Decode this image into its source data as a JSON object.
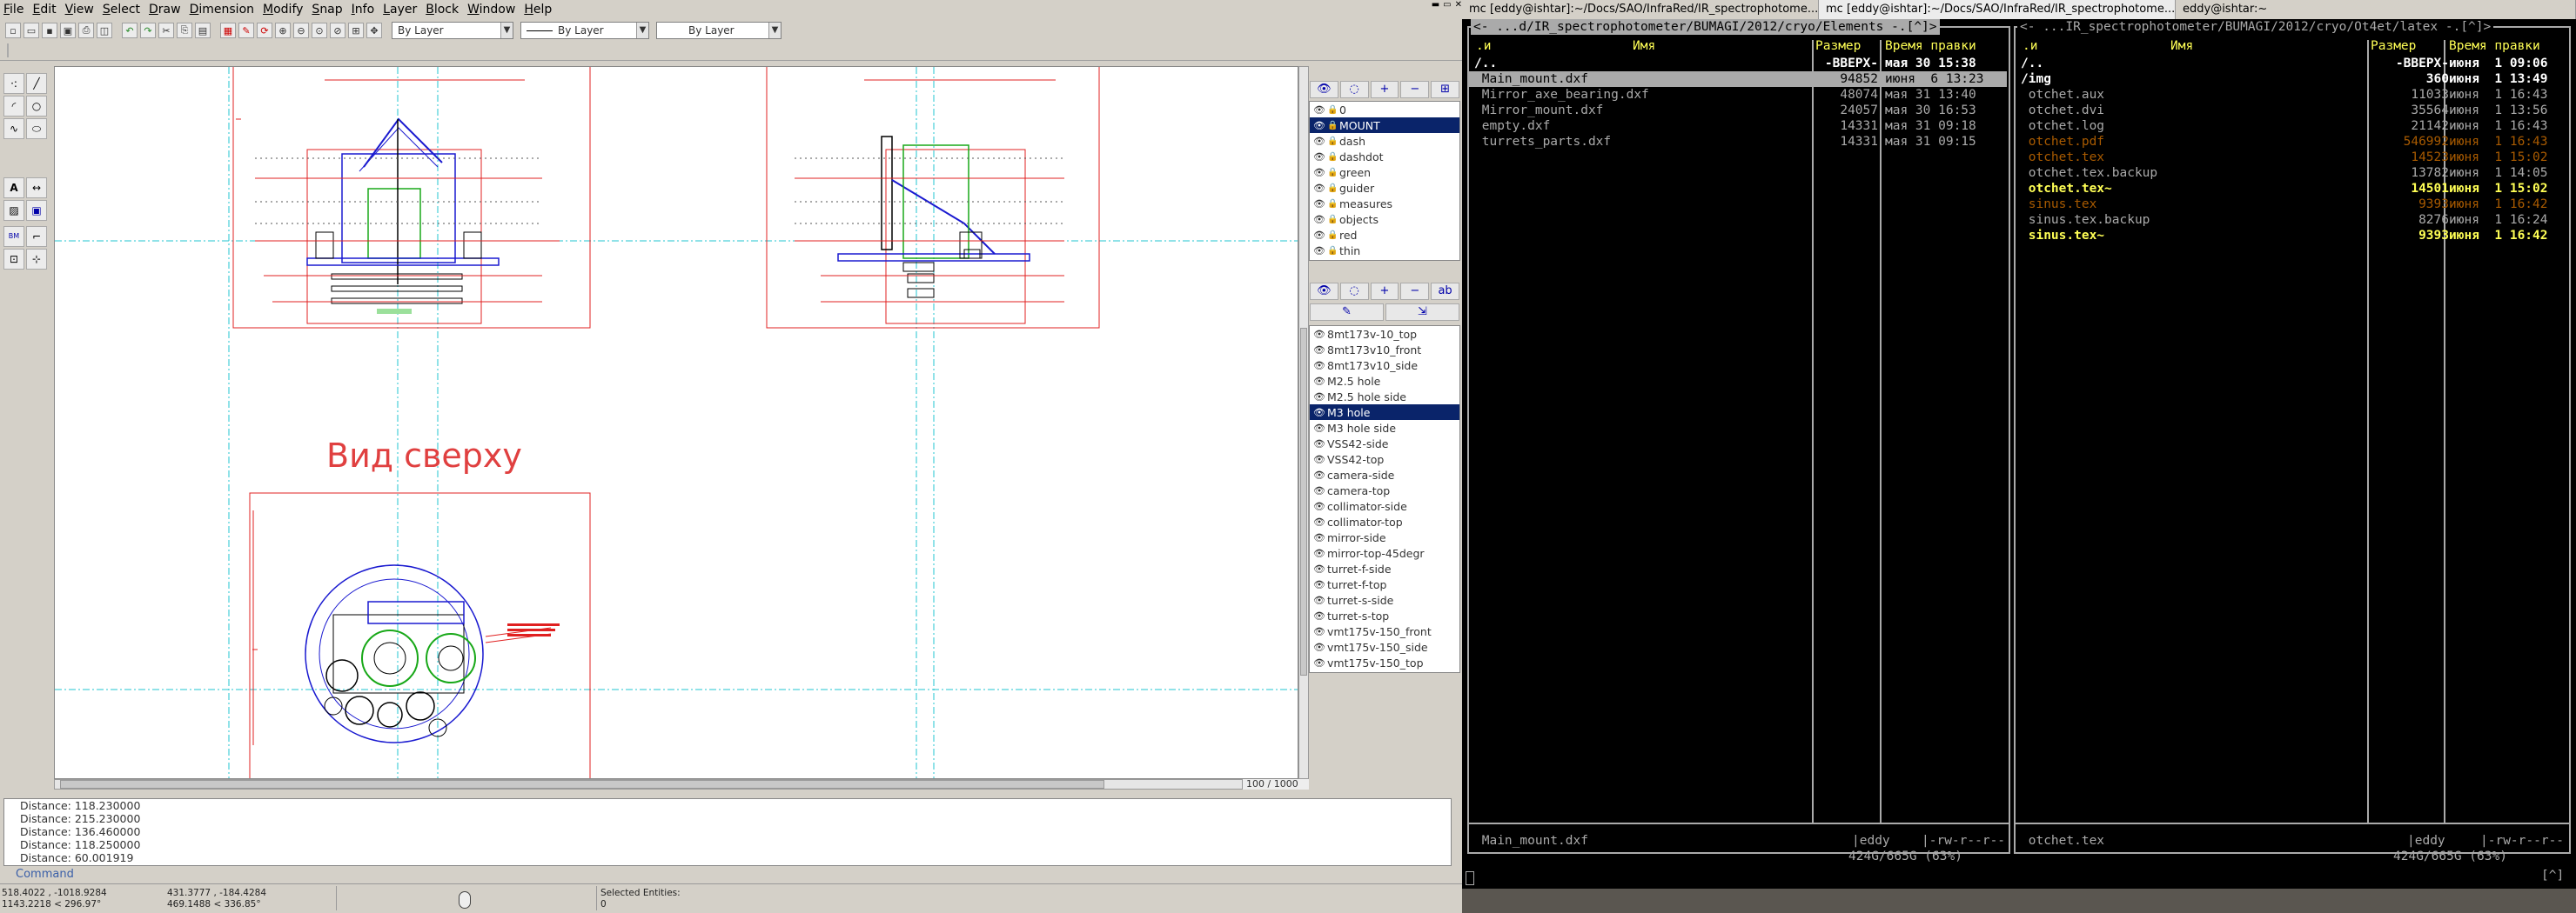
{
  "cad": {
    "menu": [
      "File",
      "Edit",
      "View",
      "Select",
      "Draw",
      "Dimension",
      "Modify",
      "Snap",
      "Info",
      "Layer",
      "Block",
      "Window",
      "Help"
    ],
    "pen_color": "By Layer",
    "pen_linetype": "By Layer",
    "pen_width": "By Layer",
    "drawing": {
      "view_label": "Вид сверху"
    },
    "zoom": "100 / 1000",
    "layers": [
      {
        "name": "0",
        "selected": false
      },
      {
        "name": "MOUNT",
        "selected": true
      },
      {
        "name": "dash",
        "selected": false
      },
      {
        "name": "dashdot",
        "selected": false
      },
      {
        "name": "green",
        "selected": false
      },
      {
        "name": "guider",
        "selected": false
      },
      {
        "name": "measures",
        "selected": false
      },
      {
        "name": "objects",
        "selected": false
      },
      {
        "name": "red",
        "selected": false
      },
      {
        "name": "thin",
        "selected": false
      }
    ],
    "blocks": [
      {
        "name": "8mt173v-10_top",
        "selected": false
      },
      {
        "name": "8mt173v10_front",
        "selected": false
      },
      {
        "name": "8mt173v10_side",
        "selected": false
      },
      {
        "name": "M2.5 hole",
        "selected": false
      },
      {
        "name": "M2.5 hole side",
        "selected": false
      },
      {
        "name": "M3 hole",
        "selected": true
      },
      {
        "name": "M3 hole side",
        "selected": false
      },
      {
        "name": "VSS42-side",
        "selected": false
      },
      {
        "name": "VSS42-top",
        "selected": false
      },
      {
        "name": "camera-side",
        "selected": false
      },
      {
        "name": "camera-top",
        "selected": false
      },
      {
        "name": "collimator-side",
        "selected": false
      },
      {
        "name": "collimator-top",
        "selected": false
      },
      {
        "name": "mirror-side",
        "selected": false
      },
      {
        "name": "mirror-top-45degr",
        "selected": false
      },
      {
        "name": "turret-f-side",
        "selected": false
      },
      {
        "name": "turret-f-top",
        "selected": false
      },
      {
        "name": "turret-s-side",
        "selected": false
      },
      {
        "name": "turret-s-top",
        "selected": false
      },
      {
        "name": "vmt175v-150_front",
        "selected": false
      },
      {
        "name": "vmt175v-150_side",
        "selected": false
      },
      {
        "name": "vmt175v-150_top",
        "selected": false
      }
    ],
    "command_history": [
      "Distance: 118.230000",
      "Distance: 215.230000",
      "Distance: 136.460000",
      "Distance: 118.250000",
      "Distance: 60.001919"
    ],
    "command_label": "Command",
    "status": {
      "coord_abs_1": "518.4022 , -1018.9284",
      "coord_abs_2": "1143.2218 < 296.97°",
      "coord_rel_1": "431.3777 , -184.4284",
      "coord_rel_2": "469.1488 < 336.85°",
      "selected_label": "Selected Entities:",
      "selected_count": "0"
    }
  },
  "tabs": [
    {
      "label": "mc [eddy@ishtar]:~/Docs/SAO/InfraRed/IR_spectrophotome...",
      "active": false
    },
    {
      "label": "mc [eddy@ishtar]:~/Docs/SAO/InfraRed/IR_spectrophotome...",
      "active": true
    },
    {
      "label": "eddy@ishtar:~",
      "active": false
    }
  ],
  "mc": {
    "left": {
      "path": "<- ...d/IR_spectrophotometer/BUMAGI/2012/cryo/Elements -.[^]>",
      "col_type": ".и",
      "col_name": "Имя",
      "col_size": "Размер",
      "col_time": "Время правки",
      "files": [
        {
          "name": "/..",
          "size": "-ВВЕРХ-",
          "time": "мая 30 15:38",
          "style": "dir"
        },
        {
          "name": " Main_mount.dxf",
          "size": "94852",
          "time": "июня  6 13:23",
          "style": "sel"
        },
        {
          "name": " Mirror_axe_bearing.dxf",
          "size": "48074",
          "time": "мая 31 13:40",
          "style": "file"
        },
        {
          "name": " Mirror_mount.dxf",
          "size": "24057",
          "time": "мая 30 16:53",
          "style": "file"
        },
        {
          "name": " empty.dxf",
          "size": "14331",
          "time": "мая 31 09:18",
          "style": "file"
        },
        {
          "name": " turrets_parts.dxf",
          "size": "14331",
          "time": "мая 31 09:15",
          "style": "file"
        }
      ],
      "footer_name": " Main_mount.dxf",
      "footer_owner": "|eddy",
      "footer_perm": "|-rw-r--r--",
      "disk": "424G/665G (63%)"
    },
    "right": {
      "path": "<- ...IR_spectrophotometer/BUMAGI/2012/cryo/Ot4et/latex -.[^]>",
      "col_type": ".и",
      "col_name": "Имя",
      "col_size": "Размер",
      "col_time": "Время правки",
      "files": [
        {
          "name": "/..",
          "size": "-ВВЕРХ-",
          "time": "июня  1 09:06",
          "style": "dir"
        },
        {
          "name": "/img",
          "size": "360",
          "time": "июня  1 13:49",
          "style": "dir"
        },
        {
          "name": " otchet.aux",
          "size": "11033",
          "time": "июня  1 16:43",
          "style": "file"
        },
        {
          "name": " otchet.dvi",
          "size": "35564",
          "time": "июня  1 13:56",
          "style": "file"
        },
        {
          "name": " otchet.log",
          "size": "21142",
          "time": "июня  1 16:43",
          "style": "file"
        },
        {
          "name": " otchet.pdf",
          "size": "546992",
          "time": "июня  1 16:43",
          "style": "ora"
        },
        {
          "name": " otchet.tex",
          "size": "14523",
          "time": "июня  1 15:02",
          "style": "ora"
        },
        {
          "name": " otchet.tex.backup",
          "size": "13782",
          "time": "июня  1 14:05",
          "style": "file"
        },
        {
          "name": " otchet.tex~",
          "size": "14501",
          "time": "июня  1 15:02",
          "style": "yel"
        },
        {
          "name": " sinus.tex",
          "size": "9393",
          "time": "июня  1 16:42",
          "style": "ora"
        },
        {
          "name": " sinus.tex.backup",
          "size": "8276",
          "time": "июня  1 16:24",
          "style": "file"
        },
        {
          "name": " sinus.tex~",
          "size": "9393",
          "time": "июня  1 16:42",
          "style": "yel"
        }
      ],
      "footer_name": " otchet.tex",
      "footer_owner": "|eddy",
      "footer_perm": "|-rw-r--r--",
      "disk": "424G/665G (63%)"
    },
    "prompt_right": "[^]"
  }
}
